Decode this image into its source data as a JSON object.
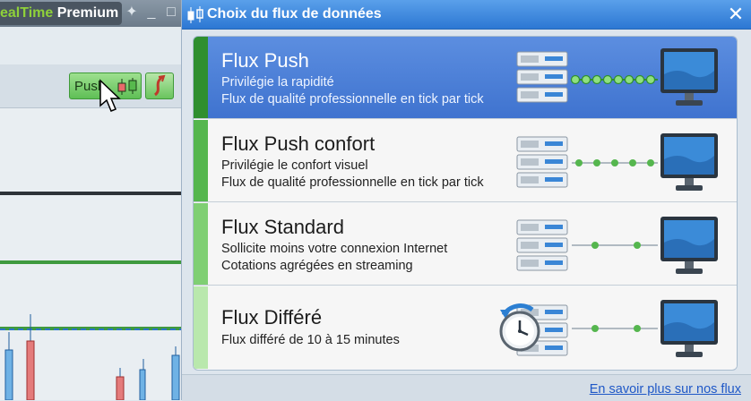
{
  "background_app": {
    "title_part1": "ealTime",
    "title_part2": "Premium",
    "push_button_label": "Push"
  },
  "dialog": {
    "title": "Choix du flux de données",
    "close_label": "✕",
    "options": [
      {
        "title": "Flux Push",
        "lines": [
          "Privilégie la rapidité",
          "Flux de qualité professionnelle en tick par tick"
        ],
        "selected": true,
        "bar_color": "#2f8f2f"
      },
      {
        "title": "Flux Push confort",
        "lines": [
          "Privilégie le confort visuel",
          "Flux de qualité professionnelle en tick par tick"
        ],
        "selected": false,
        "bar_color": "#55b64e"
      },
      {
        "title": "Flux Standard",
        "lines": [
          "Sollicite moins votre connexion Internet",
          "Cotations agrégées en streaming"
        ],
        "selected": false,
        "bar_color": "#7fcf73"
      },
      {
        "title": "Flux Différé",
        "lines": [
          "Flux différé de 10 à 15 minutes"
        ],
        "selected": false,
        "bar_color": "#b9e8ad"
      }
    ],
    "footer_link": "En savoir plus sur nos flux"
  },
  "colors": {
    "selected_bg": "#4a7fd6",
    "accent_green": "#3fae3f",
    "link": "#1f58c7"
  },
  "icons": [
    "server-stack-icon",
    "monitor-icon",
    "clock-icon",
    "close-icon",
    "candlestick-icon",
    "cursor-icon"
  ]
}
